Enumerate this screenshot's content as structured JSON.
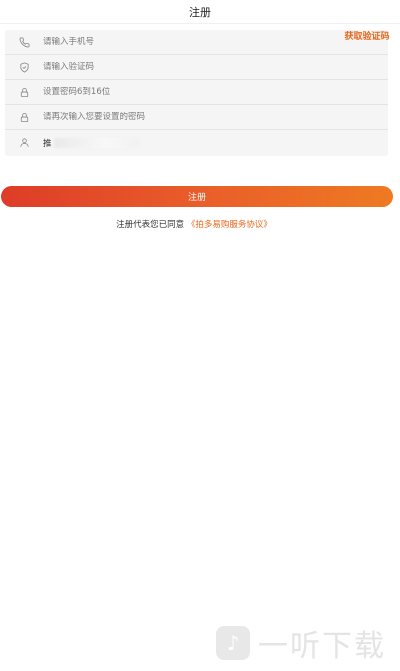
{
  "header": {
    "title": "注册"
  },
  "form": {
    "phone": {
      "placeholder": "请输入手机号",
      "icon": "phone-icon"
    },
    "code": {
      "placeholder": "请输入验证码",
      "icon": "shield-icon"
    },
    "get_code_label": "获取验证码",
    "password": {
      "placeholder": "设置密码6到16位",
      "icon": "lock-icon"
    },
    "confirm_password": {
      "placeholder": "请再次输入您要设置的密码",
      "icon": "lock-icon"
    },
    "referrer": {
      "value": "推",
      "icon": "user-icon"
    }
  },
  "submit_label": "注册",
  "agreement": {
    "prefix": "注册代表您已同意",
    "link": "《拍多易购服务协议》"
  },
  "watermark": {
    "text": "一听下载"
  },
  "colors": {
    "accent": "#e8661c",
    "button_start": "#de3c28",
    "button_end": "#ee7a22"
  }
}
